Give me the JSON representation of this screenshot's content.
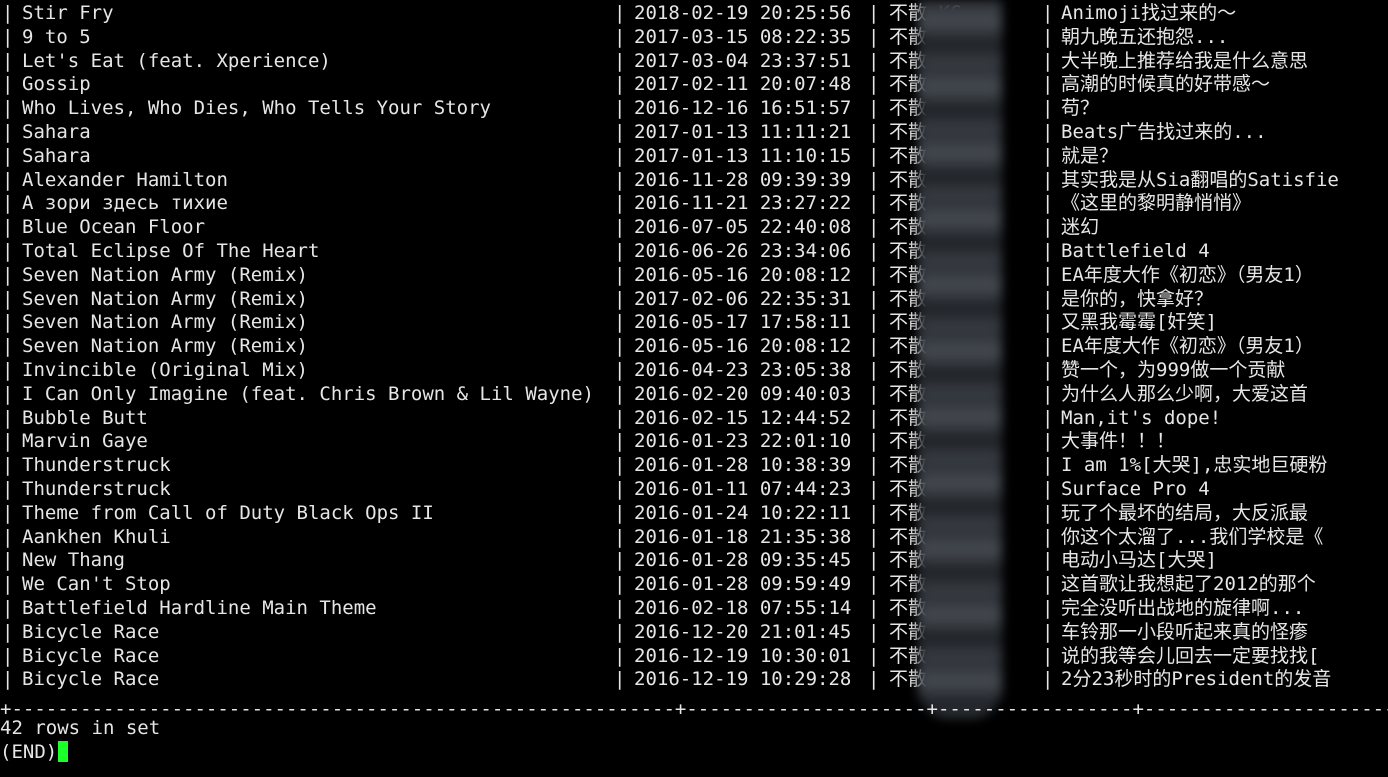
{
  "terminal": {
    "rows": [
      {
        "song": "Stir Fry",
        "time": "2018-02-19 20:25:56",
        "user": "不散",
        "user_tail": "KC",
        "comment": "Animoji找过来的～"
      },
      {
        "song": "9 to 5",
        "time": "2017-03-15 08:22:35",
        "user": "不散",
        "user_tail": "KC",
        "comment": "朝九晚五还抱怨..."
      },
      {
        "song": "Let's Eat (feat. Xperience)",
        "time": "2017-03-04 23:37:51",
        "user": "不散",
        "user_tail": "KC",
        "comment": "大半晚上推荐给我是什么意思"
      },
      {
        "song": "Gossip",
        "time": "2017-02-11 20:07:48",
        "user": "不散",
        "user_tail": "KC",
        "comment": "高潮的时候真的好带感～"
      },
      {
        "song": "Who Lives, Who Dies, Who Tells Your Story",
        "time": "2016-12-16 16:51:57",
        "user": "不散",
        "user_tail": "KC",
        "comment": "苟？"
      },
      {
        "song": "Sahara",
        "time": "2017-01-13 11:11:21",
        "user": "不散",
        "user_tail": "KC",
        "comment": "Beats广告找过来的..."
      },
      {
        "song": "Sahara",
        "time": "2017-01-13 11:10:15",
        "user": "不散",
        "user_tail": "KC",
        "comment": "就是？"
      },
      {
        "song": "Alexander Hamilton",
        "time": "2016-11-28 09:39:39",
        "user": "不散",
        "user_tail": "KC",
        "comment": "其实我是从Sia翻唱的Satisfie"
      },
      {
        "song": "А зори здесь тихие",
        "time": "2016-11-21 23:27:22",
        "user": "不散",
        "user_tail": "KC",
        "comment": "《这里的黎明静悄悄》"
      },
      {
        "song": "Blue Ocean Floor",
        "time": "2016-07-05 22:40:08",
        "user": "不散",
        "user_tail": "KC",
        "comment": "迷幻"
      },
      {
        "song": "Total Eclipse Of The Heart",
        "time": "2016-06-26 23:34:06",
        "user": "不散",
        "user_tail": "KC",
        "comment": "Battlefield 4"
      },
      {
        "song": "Seven Nation Army (Remix)",
        "time": "2016-05-16 20:08:12",
        "user": "不散",
        "user_tail": "KC",
        "comment": "EA年度大作《初恋》（男友1）"
      },
      {
        "song": "Seven Nation Army (Remix)",
        "time": "2017-02-06 22:35:31",
        "user": "不散",
        "user_tail": "KC",
        "comment": "是你的，快拿好？"
      },
      {
        "song": "Seven Nation Army (Remix)",
        "time": "2016-05-17 17:58:11",
        "user": "不散",
        "user_tail": "KC",
        "comment": "又黑我霉霉[奸笑]"
      },
      {
        "song": "Seven Nation Army (Remix)",
        "time": "2016-05-16 20:08:12",
        "user": "不散",
        "user_tail": "弦KC",
        "comment": "EA年度大作《初恋》（男友1）"
      },
      {
        "song": "Invincible (Original Mix)",
        "time": "2016-04-23 23:05:38",
        "user": "不散",
        "user_tail": "弦KC",
        "comment": "赞一个，为999做一个贡献"
      },
      {
        "song": "I Can Only Imagine (feat. Chris Brown & Lil Wayne)",
        "time": "2016-02-20 09:40:03",
        "user": "不散",
        "user_tail": "KC",
        "comment": "为什么人那么少啊，大爱这首"
      },
      {
        "song": "Bubble Butt",
        "time": "2016-02-15 12:44:52",
        "user": "不散",
        "user_tail": "KC",
        "comment": "Man,it's dope!"
      },
      {
        "song": "Marvin Gaye",
        "time": "2016-01-23 22:01:10",
        "user": "不散",
        "user_tail": "KC",
        "comment": "大事件！！！"
      },
      {
        "song": "Thunderstruck",
        "time": "2016-01-28 10:38:39",
        "user": "不散",
        "user_tail": "弦KC",
        "comment": "I am 1%[大哭],忠实地巨硬粉"
      },
      {
        "song": "Thunderstruck",
        "time": "2016-01-11 07:44:23",
        "user": "不散",
        "user_tail": "KC",
        "comment": "Surface Pro 4"
      },
      {
        "song": "Theme from Call of Duty Black Ops II",
        "time": "2016-01-24 10:22:11",
        "user": "不散",
        "user_tail": "KC",
        "comment": "玩了个最坏的结局，大反派最"
      },
      {
        "song": "Aankhen Khuli",
        "time": "2016-01-18 21:35:38",
        "user": "不散",
        "user_tail": "KC",
        "comment": "你这个太溜了...我们学校是《"
      },
      {
        "song": "New Thang",
        "time": "2016-01-28 09:35:45",
        "user": "不散",
        "user_tail": "KC",
        "comment": "电动小马达[大哭]"
      },
      {
        "song": "We Can't Stop",
        "time": "2016-01-28 09:59:49",
        "user": "不散",
        "user_tail": "KC",
        "comment": "这首歌让我想起了2012的那个"
      },
      {
        "song": "Battlefield Hardline Main Theme",
        "time": "2016-02-18 07:55:14",
        "user": "不散",
        "user_tail": "KC",
        "comment": "完全没听出战地的旋律啊..."
      },
      {
        "song": "Bicycle Race",
        "time": "2016-12-20 21:01:45",
        "user": "不散",
        "user_tail": "KC",
        "comment": "车铃那一小段听起来真的怪瘆"
      },
      {
        "song": "Bicycle Race",
        "time": "2016-12-19 10:30:01",
        "user": "不散",
        "user_tail": "弦KC",
        "comment": "说的我等会儿回去一定要找找["
      },
      {
        "song": "Bicycle Race",
        "time": "2016-12-19 10:29:28",
        "user": "不散",
        "user_tail": "弦KC",
        "comment": "2分23秒时的President的发音"
      }
    ],
    "separator": "+----------------------------------------------------------+---------------------+-----------------+--------------------------------",
    "row_count": "42 rows in set",
    "pager": "(END)",
    "colors": {
      "background": "#000000",
      "text": "#e6e6e6",
      "cursor": "#1bff2b"
    }
  }
}
